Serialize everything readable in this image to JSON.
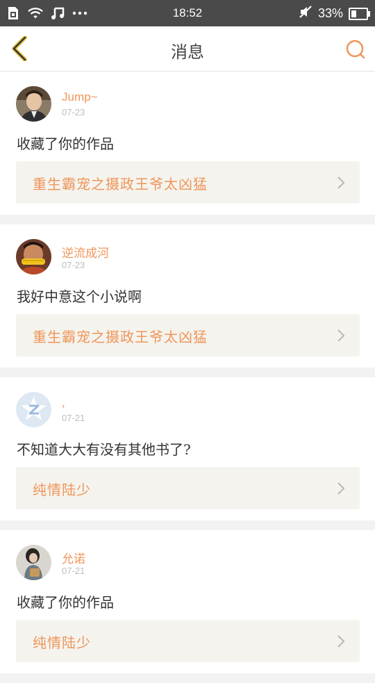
{
  "status": {
    "time": "18:52",
    "battery": "33%",
    "battery_level": 0.33
  },
  "header": {
    "title": "消息",
    "back_icon": "chevron-left-icon",
    "search_icon": "search-icon",
    "accent": "#f0955a"
  },
  "messages": [
    {
      "user": "Jump~",
      "date": "07-23",
      "text": "收藏了你的作品",
      "work": "重生霸宠之摄政王爷太凶猛",
      "avatar": "avatar-photo-boy"
    },
    {
      "user": "逆流成河",
      "date": "07-23",
      "text": "我好中意这个小说啊",
      "work": "重生霸宠之摄政王爷太凶猛",
      "avatar": "avatar-photo-child-corn"
    },
    {
      "user": ",",
      "date": "07-21",
      "text": "不知道大大有没有其他书了?",
      "work": "纯情陆少",
      "avatar": "avatar-default-qzone"
    },
    {
      "user": "允诺",
      "date": "07-21",
      "text": "收藏了你的作品",
      "work": "纯情陆少",
      "avatar": "avatar-photo-girl"
    }
  ]
}
